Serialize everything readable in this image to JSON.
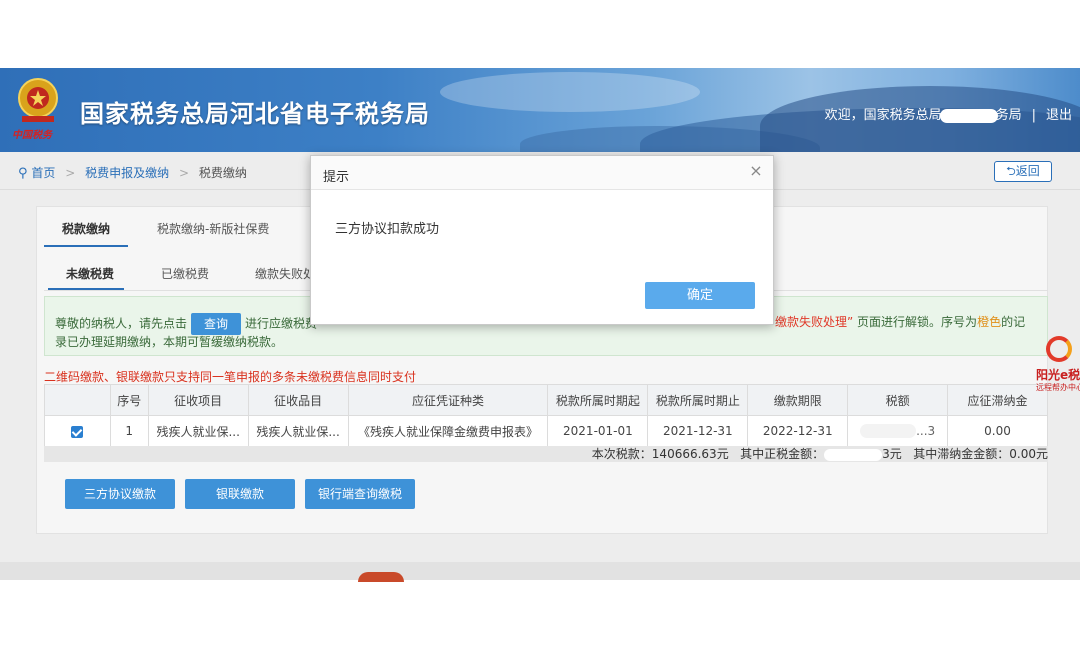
{
  "header": {
    "emblem_caption": "中国税务",
    "site_title": "国家税务总局河北省电子税务局",
    "welcome_prefix": "欢迎，国家税务总局",
    "welcome_suffix": "务局",
    "separator": "|",
    "logout": "退出"
  },
  "breadcrumb": {
    "home": "首页",
    "arrow": ">",
    "level1": "税费申报及缴纳",
    "level2": "税费缴纳",
    "back": "返回"
  },
  "tabs_primary": [
    {
      "label": "税款缴纳"
    },
    {
      "label": "税款缴纳-新版社保费"
    }
  ],
  "tabs_secondary": [
    {
      "label": "未缴税费"
    },
    {
      "label": "已缴税费"
    },
    {
      "label": "缴款失败处"
    }
  ],
  "notice": {
    "line1_a": "尊敬的纳税人，请先点击",
    "query_button": "查询",
    "line1_b": "进行应缴税费",
    "line1_right_red": "缴款失败处理”",
    "line1_right_mid": "页面进行解锁。序号为",
    "line1_right_orange": "橙色",
    "line1_right_end": "的记",
    "line2": "录已办理延期缴纳，本期可暂缓缴纳税款。"
  },
  "red_note": "二维码缴款、银联缴款只支持同一笔申报的多条未缴税费信息同时支付",
  "table": {
    "columns": [
      "",
      "序号",
      "征收项目",
      "征收品目",
      "应征凭证种类",
      "税款所属时期起",
      "税款所属时期止",
      "缴款期限",
      "税额",
      "应征滞纳金"
    ],
    "rows": [
      {
        "index": "1",
        "item": "残疾人就业保...",
        "subitem": "残疾人就业保...",
        "voucher": "《残疾人就业保障金缴费申报表》",
        "period_start": "2021-01-01",
        "period_end": "2021-12-31",
        "deadline": "2022-12-31",
        "tax_tail": "...3",
        "late_fee": "0.00"
      }
    ]
  },
  "summary": {
    "this_tax": "本次税款：140666.63元",
    "principal_label": "其中正税金额：",
    "principal_tail": "3元",
    "late_label": "其中滞纳金金额：0.00元"
  },
  "actions": [
    {
      "label": "三方协议缴款"
    },
    {
      "label": "银联缴款"
    },
    {
      "label": "银行端查询缴税"
    }
  ],
  "side_logo": {
    "title": "阳光e税",
    "subtitle": "远程帮办中心"
  },
  "modal": {
    "title": "提示",
    "close": "×",
    "message": "三方协议扣款成功",
    "ok": "确定"
  },
  "colors": {
    "primary": "#3e92d8",
    "link": "#2a6fb8",
    "warning_red": "#d9321f",
    "orange": "#e0901a"
  }
}
